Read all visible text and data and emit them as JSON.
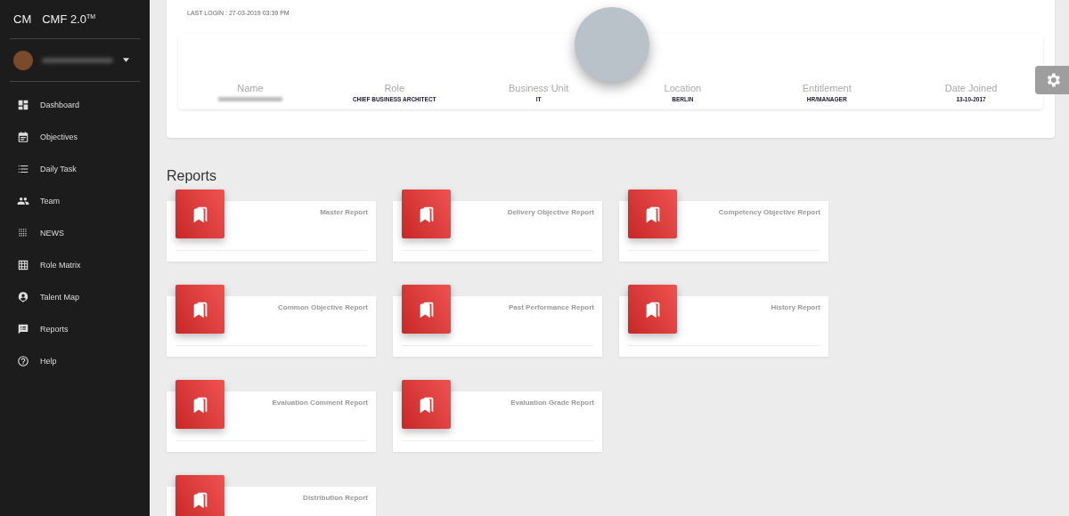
{
  "sidebar": {
    "brand_short": "CM",
    "brand": "CMF 2.0",
    "brand_mark": "TM",
    "items": [
      {
        "label": "Dashboard"
      },
      {
        "label": "Objectives"
      },
      {
        "label": "Daily Task"
      },
      {
        "label": "Team"
      },
      {
        "label": "NEWS"
      },
      {
        "label": "Role Matrix"
      },
      {
        "label": "Talent Map"
      },
      {
        "label": "Reports"
      },
      {
        "label": "Help"
      }
    ]
  },
  "profile": {
    "last_login": "LAST LOGIN : 27-03-2019 03:39 PM",
    "fields": [
      {
        "label": "Name"
      },
      {
        "label": "Role",
        "value": "CHIEF BUSINESS ARCHITECT"
      },
      {
        "label": "Business Unit",
        "value": "IT"
      },
      {
        "label": "Location",
        "value": "BERLIN"
      },
      {
        "label": "Entitlement",
        "value": "HR/MANAGER"
      },
      {
        "label": "Date Joined",
        "value": "13-10-2017"
      }
    ]
  },
  "reports": {
    "title": "Reports",
    "rows": [
      [
        {
          "label": "Master Report"
        },
        {
          "label": "Delivery Objective Report"
        },
        {
          "label": "Competency Objective Report"
        }
      ],
      [
        {
          "label": "Common Objective Report"
        },
        {
          "label": "Past Performance Report"
        },
        {
          "label": "History Report"
        }
      ],
      [
        {
          "label": "Evaluation Comment Report"
        },
        {
          "label": "Evaluation Grade Report"
        }
      ],
      [
        {
          "label": "Distribution Report"
        }
      ]
    ]
  }
}
